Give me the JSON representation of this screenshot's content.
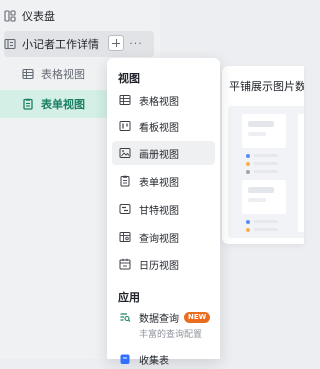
{
  "sidebar": {
    "dashboard_label": "仪表盘",
    "table_name": "小记者工作详情",
    "views": [
      {
        "label": "表格视图",
        "icon": "grid-icon"
      },
      {
        "label": "表单视图",
        "icon": "form-icon"
      }
    ]
  },
  "menu": {
    "views_section_title": "视图",
    "view_items": [
      {
        "label": "表格视图",
        "icon": "grid-icon"
      },
      {
        "label": "看板视图",
        "icon": "kanban-icon"
      },
      {
        "label": "画册视图",
        "icon": "gallery-icon"
      },
      {
        "label": "表单视图",
        "icon": "form-icon"
      },
      {
        "label": "甘特视图",
        "icon": "gantt-icon"
      },
      {
        "label": "查询视图",
        "icon": "query-icon"
      },
      {
        "label": "日历视图",
        "icon": "calendar-icon"
      }
    ],
    "apps_section_title": "应用",
    "app_items": [
      {
        "label": "数据查询",
        "badge": "NEW",
        "description": "丰富的查询配置",
        "icon": "data-query-icon"
      },
      {
        "label": "收集表",
        "icon": "collection-form-icon"
      }
    ]
  },
  "preview": {
    "title": "平铺展示图片数"
  },
  "colors": {
    "accent": "#1a7f63",
    "selected_bg": "#d3efe6",
    "badge": "#ea6d1f"
  }
}
